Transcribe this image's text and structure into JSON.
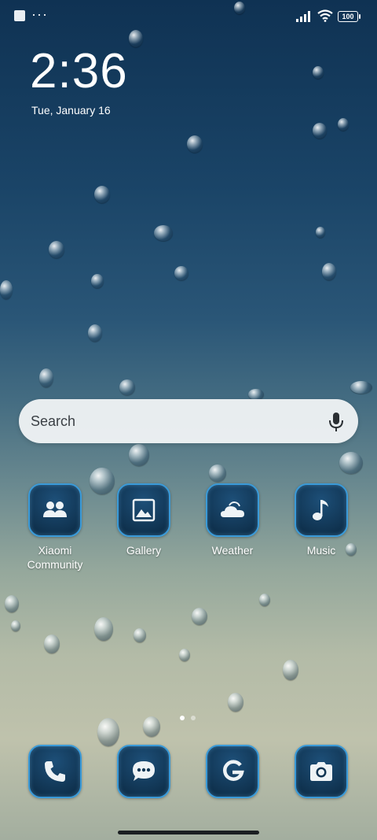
{
  "status_bar": {
    "notification_dots": "···",
    "battery_level": "100"
  },
  "clock": {
    "time": "2:36",
    "date": "Tue, January 16"
  },
  "search": {
    "placeholder": "Search"
  },
  "apps": [
    {
      "label": "Xiaomi\nCommunity",
      "icon": "people-icon"
    },
    {
      "label": "Gallery",
      "icon": "image-icon"
    },
    {
      "label": "Weather",
      "icon": "cloud-sun-icon"
    },
    {
      "label": "Music",
      "icon": "music-note-icon"
    }
  ],
  "dock": [
    {
      "icon": "phone-icon"
    },
    {
      "icon": "chat-bubble-icon"
    },
    {
      "icon": "google-icon"
    },
    {
      "icon": "camera-icon"
    }
  ],
  "page_indicator": {
    "pages": 2,
    "current": 1
  },
  "colors": {
    "icon_border": "#3a9ad8",
    "icon_fill": "#113553"
  }
}
